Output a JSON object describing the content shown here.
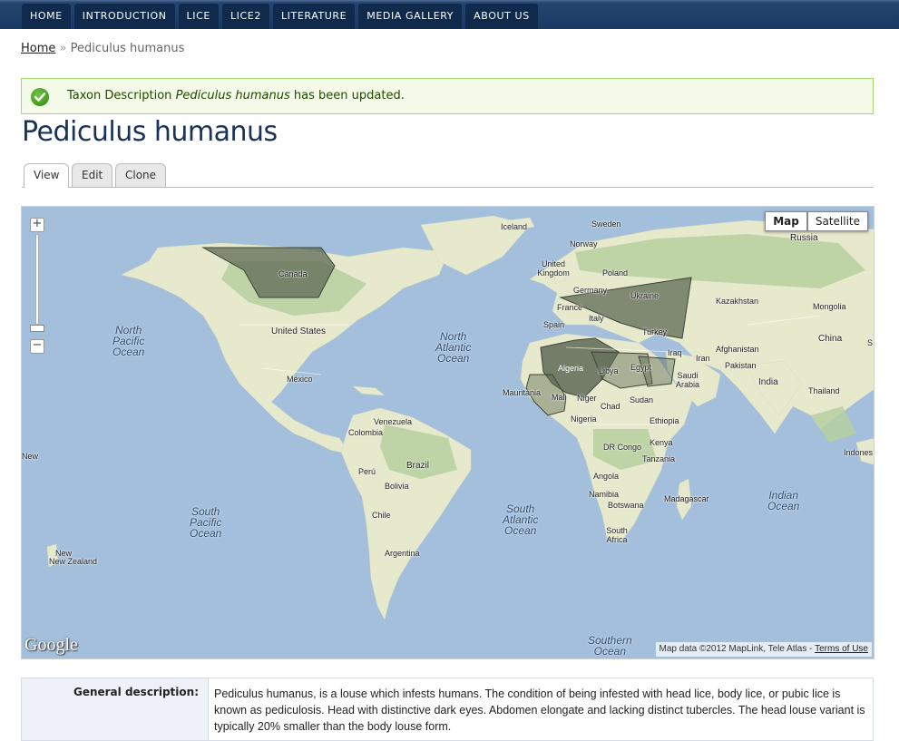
{
  "nav": {
    "items": [
      "HOME",
      "INTRODUCTION",
      "LICE",
      "LICE2",
      "LITERATURE",
      "MEDIA GALLERY",
      "ABOUT US"
    ]
  },
  "breadcrumb": {
    "home": "Home",
    "separator": "»",
    "current": "Pediculus humanus"
  },
  "status": {
    "prefix": "Taxon Description",
    "taxon": "Pediculus humanus",
    "suffix": "has been updated."
  },
  "page": {
    "title": "Pediculus humanus"
  },
  "tabs": [
    "View",
    "Edit",
    "Clone"
  ],
  "map": {
    "zoom_in": "+",
    "zoom_out": "−",
    "type_buttons": [
      "Map",
      "Satellite"
    ],
    "attribution_text": "Map data ©2012 MapLink, Tele Atlas -",
    "terms_link": "Terms of Use",
    "logo": "Google",
    "colors": {
      "ocean": "#a3bfdc",
      "land": "#e6e9cc",
      "forest": "#b6cf9f",
      "highlight": "#5e6a55"
    },
    "labels": {
      "iceland": "Iceland",
      "sweden": "Sweden",
      "norway": "Norway",
      "russia": "Russia",
      "uk": "United Kingdom",
      "poland": "Poland",
      "germany": "Germany",
      "ukraine": "Ukraine",
      "kazakhstan": "Kazakhstan",
      "mongolia": "Mongolia",
      "france": "France",
      "italy": "Italy",
      "spain": "Spain",
      "turkey": "Turkey",
      "china": "China",
      "iraq": "Iraq",
      "afghanistan": "Afghanistan",
      "iran": "Iran",
      "pakistan": "Pakistan",
      "india": "India",
      "thailand": "Thailand",
      "algeria": "Algeria",
      "libya": "Libya",
      "egypt": "Egypt",
      "saudi": "Saudi Arabia",
      "mauritania": "Mauritania",
      "mali": "Mali",
      "niger": "Niger",
      "chad": "Chad",
      "sudan": "Sudan",
      "nigeria": "Nigeria",
      "ethiopia": "Ethiopia",
      "drcongo": "DR Congo",
      "kenya": "Kenya",
      "tanzania": "Tanzania",
      "angola": "Angola",
      "namibia": "Namibia",
      "botswana": "Botswana",
      "madagascar": "Madagascar",
      "southafrica": "South Africa",
      "canada": "Canada",
      "usa": "United States",
      "mexico": "México",
      "venezuela": "Venezuela",
      "colombia": "Colombia",
      "peru": "Perú",
      "brazil": "Brazil",
      "bolivia": "Bolivia",
      "chile": "Chile",
      "argentina": "Argentina",
      "newzealand": "New Zealand",
      "newzealand_top": "New",
      "indonesia": "Indones",
      "edge_s": "S"
    },
    "oceans": {
      "north_pacific": "North\nPacific\nOcean",
      "north_atlantic": "North\nAtlantic\nOcean",
      "south_pacific": "South\nPacific\nOcean",
      "south_atlantic": "South\nAtlantic\nOcean",
      "indian": "Indian\nOcean",
      "southern": "Southern\nOcean"
    }
  },
  "description": {
    "label": "General description:",
    "text": "Pediculus humanus, is a louse which infests humans. The condition of being infested with head lice, body lice, or pubic lice is known as pediculosis. Head with distinctive dark eyes. Abdomen elongate and lacking distinct tubercles. The head louse variant is typically 20% smaller than the body louse form."
  }
}
